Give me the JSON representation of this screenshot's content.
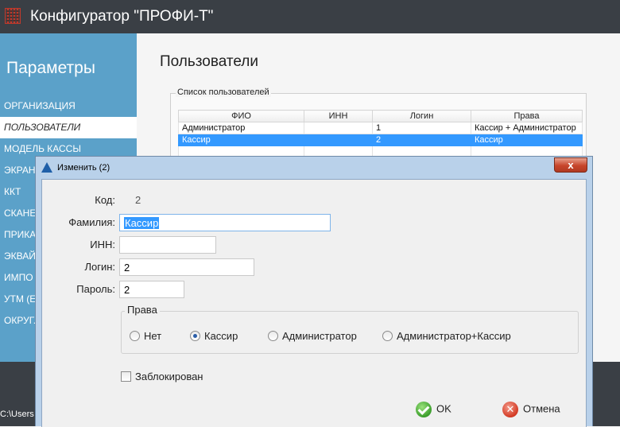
{
  "window": {
    "title": "Конфигуратор \"ПРОФИ-Т\""
  },
  "sidebar": {
    "title": "Параметры",
    "items": [
      {
        "label": "ОРГАНИЗАЦИЯ"
      },
      {
        "label": "ПОЛЬЗОВАТЕЛИ"
      },
      {
        "label": "МОДЕЛЬ КАССЫ"
      },
      {
        "label": "ЭКРАН"
      },
      {
        "label": "ККТ"
      },
      {
        "label": "СКАНЕ"
      },
      {
        "label": "ПРИКА"
      },
      {
        "label": "ЭКВАЙ"
      },
      {
        "label": "ИМПО"
      },
      {
        "label": "УТМ (Е"
      },
      {
        "label": "ОКРУГ."
      }
    ]
  },
  "main": {
    "page_title": "Пользователи",
    "users_group_label": "Список пользователей",
    "table": {
      "columns": [
        "ФИО",
        "ИНН",
        "Логин",
        "Права"
      ],
      "rows": [
        {
          "fio": "Администратор",
          "inn": "",
          "login": "1",
          "rights": "Кассир + Администратор"
        },
        {
          "fio": "Кассир",
          "inn": "",
          "login": "2",
          "rights": "Кассир"
        }
      ]
    }
  },
  "footer": {
    "path": "C:\\Users"
  },
  "dialog": {
    "title": "Изменить  (2)",
    "close_label": "x",
    "code_label": "Код:",
    "code_value": "2",
    "surname_label": "Фамилия:",
    "surname_value": "Кассир",
    "inn_label": "ИНН:",
    "inn_value": "",
    "login_label": "Логин:",
    "login_value": "2",
    "password_label": "Пароль:",
    "password_value": "2",
    "rights_label": "Права",
    "rights_options": [
      {
        "label": "Нет",
        "checked": false
      },
      {
        "label": "Кассир",
        "checked": true
      },
      {
        "label": "Администратор",
        "checked": false
      },
      {
        "label": "Администратор+Кассир",
        "checked": false
      }
    ],
    "blocked_label": "Заблокирован",
    "blocked_checked": false,
    "ok_label": "OK",
    "cancel_label": "Отмена",
    "cancel_icon_glyph": "✕"
  },
  "colors": {
    "sidebar_bg": "#5ba1c9",
    "titlebar_bg": "#3a3f45",
    "selection": "#3399ff"
  }
}
